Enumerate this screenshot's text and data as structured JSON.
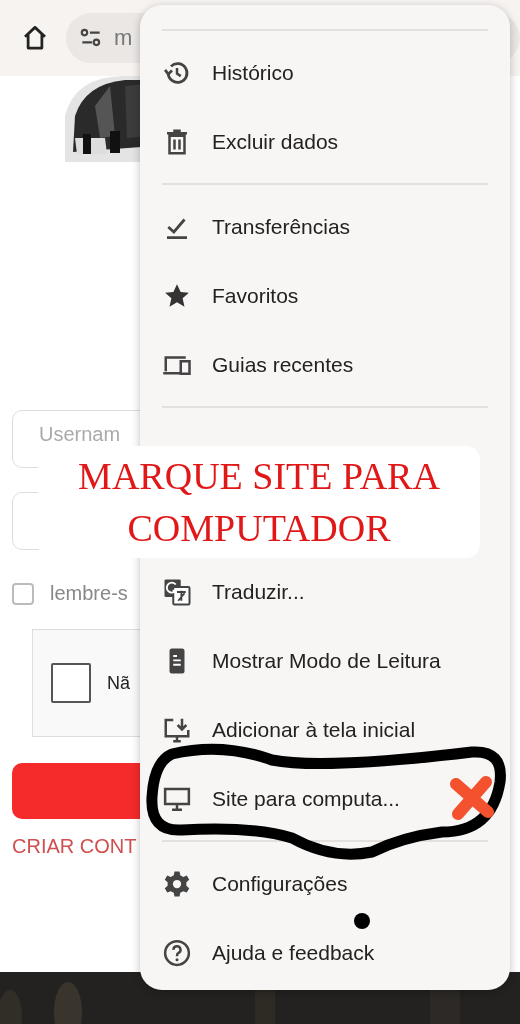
{
  "toolbar": {
    "url": "m"
  },
  "page": {
    "username_placeholder": "Usernam",
    "remember": {
      "label": "lembre-s",
      "checked": false
    },
    "captcha": {
      "label": "Nã",
      "checked": false
    },
    "create_account_link": "CRIAR CONT"
  },
  "menu": {
    "sections": [
      {
        "items": [
          {
            "label": "Histórico"
          },
          {
            "label": "Excluir dados"
          }
        ]
      },
      {
        "items": [
          {
            "label": "Transferências"
          },
          {
            "label": "Favoritos"
          },
          {
            "label": "Guias recentes"
          }
        ]
      },
      {
        "items": [
          {
            "label": "Traduzir..."
          },
          {
            "label": "Mostrar Modo de Leitura"
          },
          {
            "label": "Adicionar à tela inicial"
          },
          {
            "label": "Site para computa..."
          }
        ]
      },
      {
        "items": [
          {
            "label": "Configurações"
          },
          {
            "label": "Ajuda e feedback"
          }
        ]
      }
    ]
  },
  "annotation": {
    "lines": [
      "MARQUE SITE PARA",
      "COMPUTADOR"
    ]
  }
}
